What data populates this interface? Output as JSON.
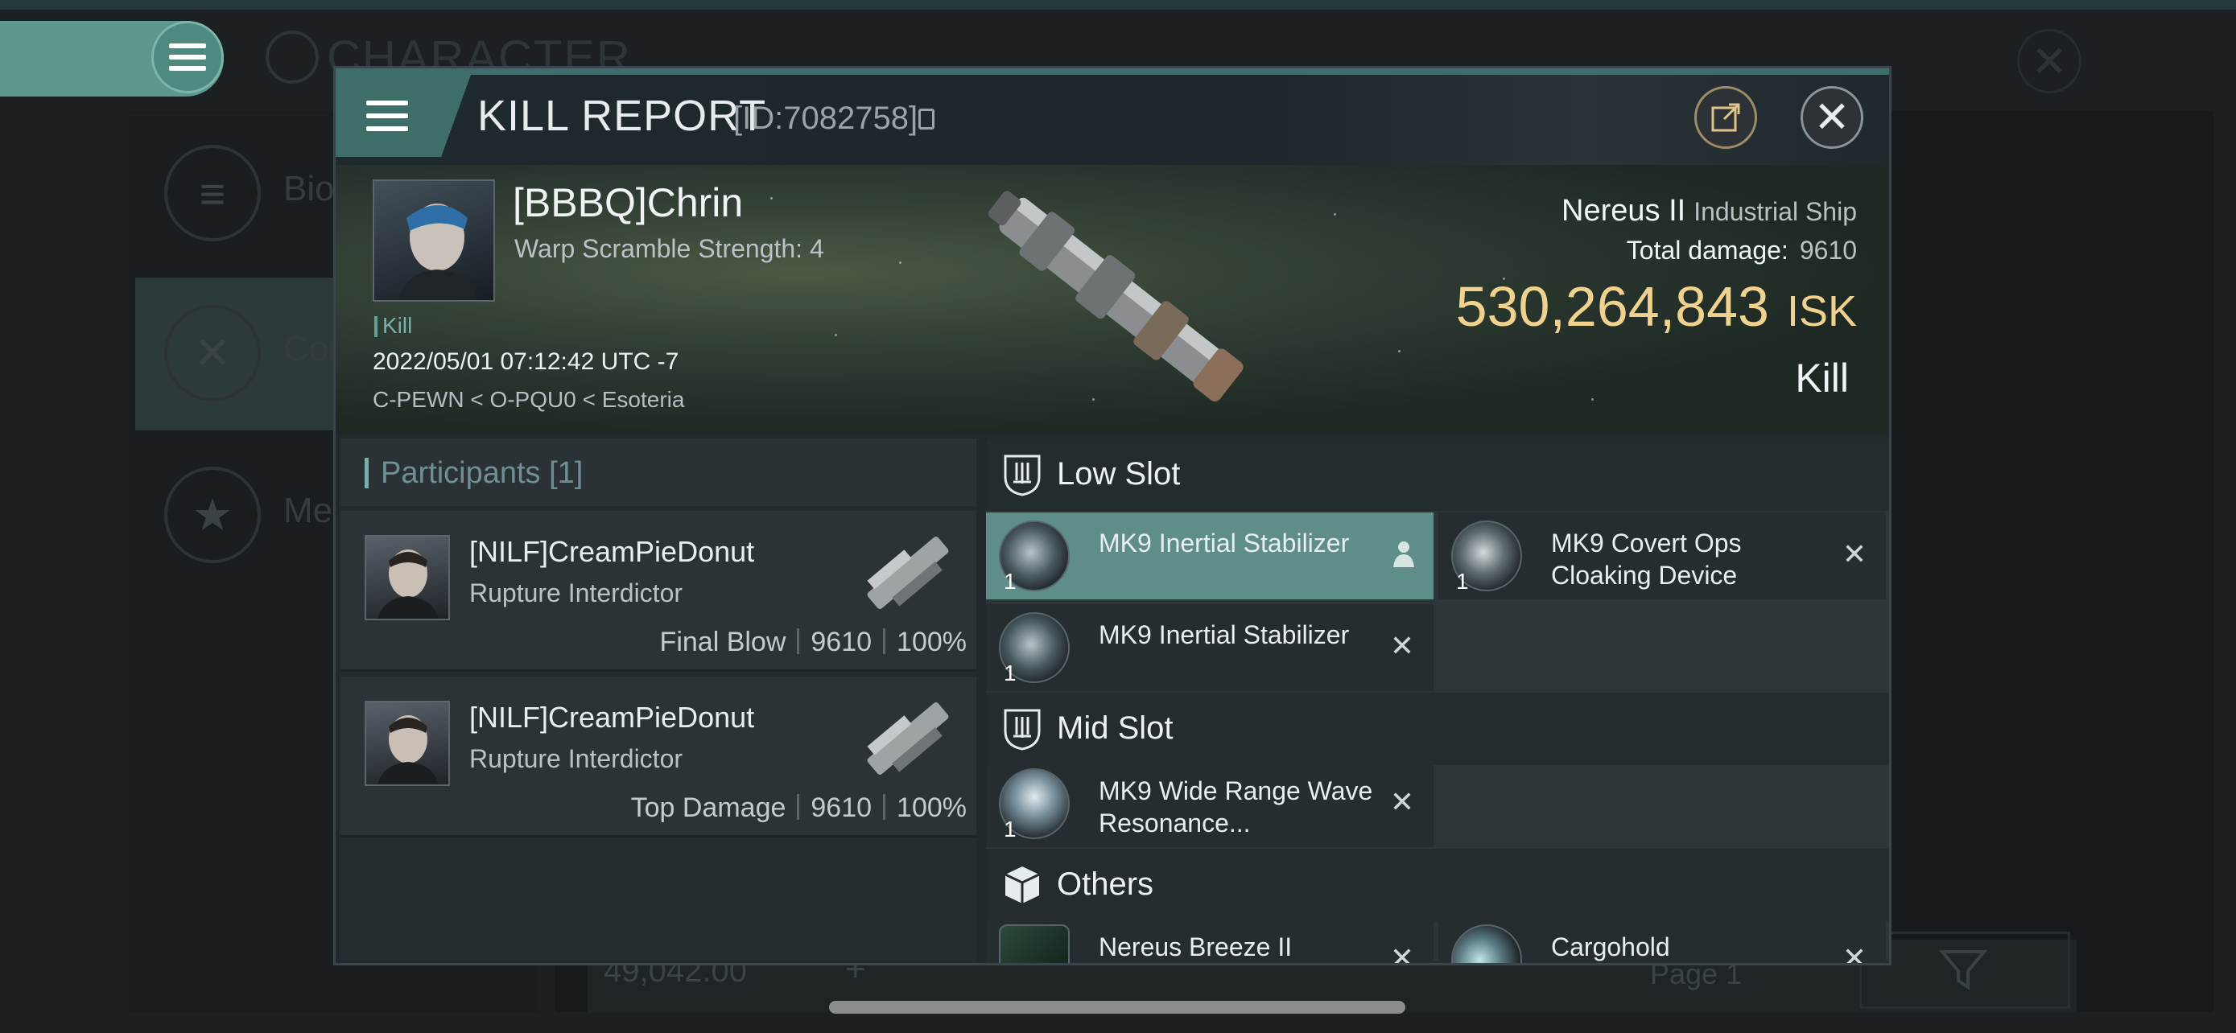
{
  "background": {
    "screen_title": "CHARACTER",
    "sidebar_items": [
      "Bio",
      "Com",
      "Me"
    ],
    "isk_amount": "49,042.00",
    "page_label": "Page 1"
  },
  "modal": {
    "title": "KILL REPORT",
    "id": "[ID:7082758]"
  },
  "victim": {
    "name": "[BBBQ]Chrin",
    "warp_scramble": "Warp Scramble Strength: 4",
    "tag": "Kill",
    "datetime": "2022/05/01 07:12:42 UTC -7",
    "location": "C-PEWN < O-PQU0 < Esoteria"
  },
  "ship": {
    "name": "Nereus II",
    "class": "Industrial Ship",
    "total_damage_label": "Total damage:",
    "total_damage": "9610",
    "value": "530,264,843",
    "currency": "ISK",
    "result": "Kill"
  },
  "participants": {
    "title": "Participants [1]",
    "rows": [
      {
        "name": "[NILF]CreamPieDonut",
        "ship": "Rupture Interdictor",
        "role": "Final Blow",
        "damage": "9610",
        "percent": "100%"
      },
      {
        "name": "[NILF]CreamPieDonut",
        "ship": "Rupture Interdictor",
        "role": "Top Damage",
        "damage": "9610",
        "percent": "100%"
      }
    ]
  },
  "fittings": {
    "low_slot": {
      "title": "Low Slot",
      "items": [
        {
          "name": "MK9 Inertial Stabilizer",
          "qty": "1",
          "state": "active"
        },
        {
          "name": "MK9 Covert Ops Cloaking Device",
          "qty": "1",
          "state": "destroyed"
        },
        {
          "name": "MK9 Inertial Stabilizer",
          "qty": "1",
          "state": "destroyed"
        }
      ]
    },
    "mid_slot": {
      "title": "Mid Slot",
      "items": [
        {
          "name": "MK9 Wide Range Wave Resonance...",
          "qty": "1",
          "state": "destroyed"
        }
      ]
    },
    "others": {
      "title": "Others",
      "items": [
        {
          "name": "Nereus Breeze II",
          "state": "destroyed"
        },
        {
          "name": "Cargohold",
          "state": "destroyed"
        }
      ]
    }
  },
  "icons": {
    "x": "✕",
    "colors": {
      "accent": "#5f8e88",
      "isk": "#f0d28e",
      "teal": "#6fb3aa"
    }
  }
}
